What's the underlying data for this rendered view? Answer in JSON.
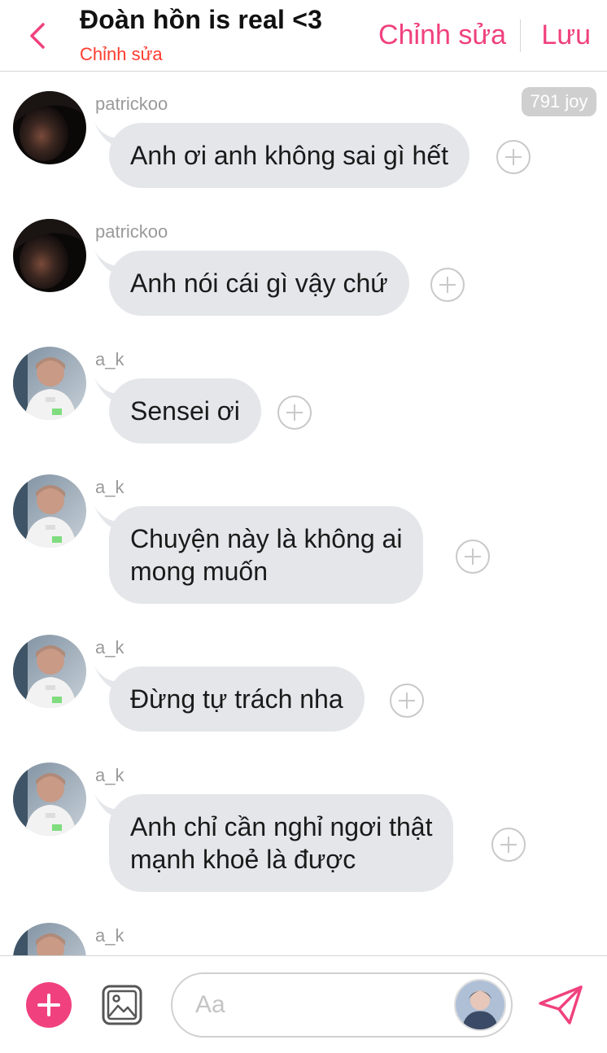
{
  "header": {
    "title": "Đoàn hồn is real <3",
    "subtitle": "Chỉnh sửa",
    "edit_label": "Chỉnh sửa",
    "save_label": "Lưu",
    "back_icon": "chevron-left-icon"
  },
  "joy_badge": "791 joy",
  "messages": [
    {
      "username": "patrickoo",
      "lines": [
        "Anh ơi anh không sai gì hết"
      ]
    },
    {
      "username": "patrickoo",
      "lines": [
        "Anh nói cái gì vậy chứ"
      ]
    },
    {
      "username": "a_k",
      "lines": [
        "Sensei ơi"
      ]
    },
    {
      "username": "a_k",
      "lines": [
        "Chuyện này là không ai",
        "mong muốn"
      ]
    },
    {
      "username": "a_k",
      "lines": [
        "Đừng tự trách nha"
      ]
    },
    {
      "username": "a_k",
      "lines": [
        "Anh chỉ cần nghỉ ngơi thật",
        "mạnh khoẻ là được"
      ]
    },
    {
      "username": "a_k",
      "lines": []
    }
  ],
  "composer": {
    "placeholder": "Aa",
    "value": ""
  },
  "colors": {
    "accent": "#f0417e",
    "subtitle": "#ff3b2f",
    "bubble": "#e4e6ea",
    "username": "#9a9a9a"
  }
}
